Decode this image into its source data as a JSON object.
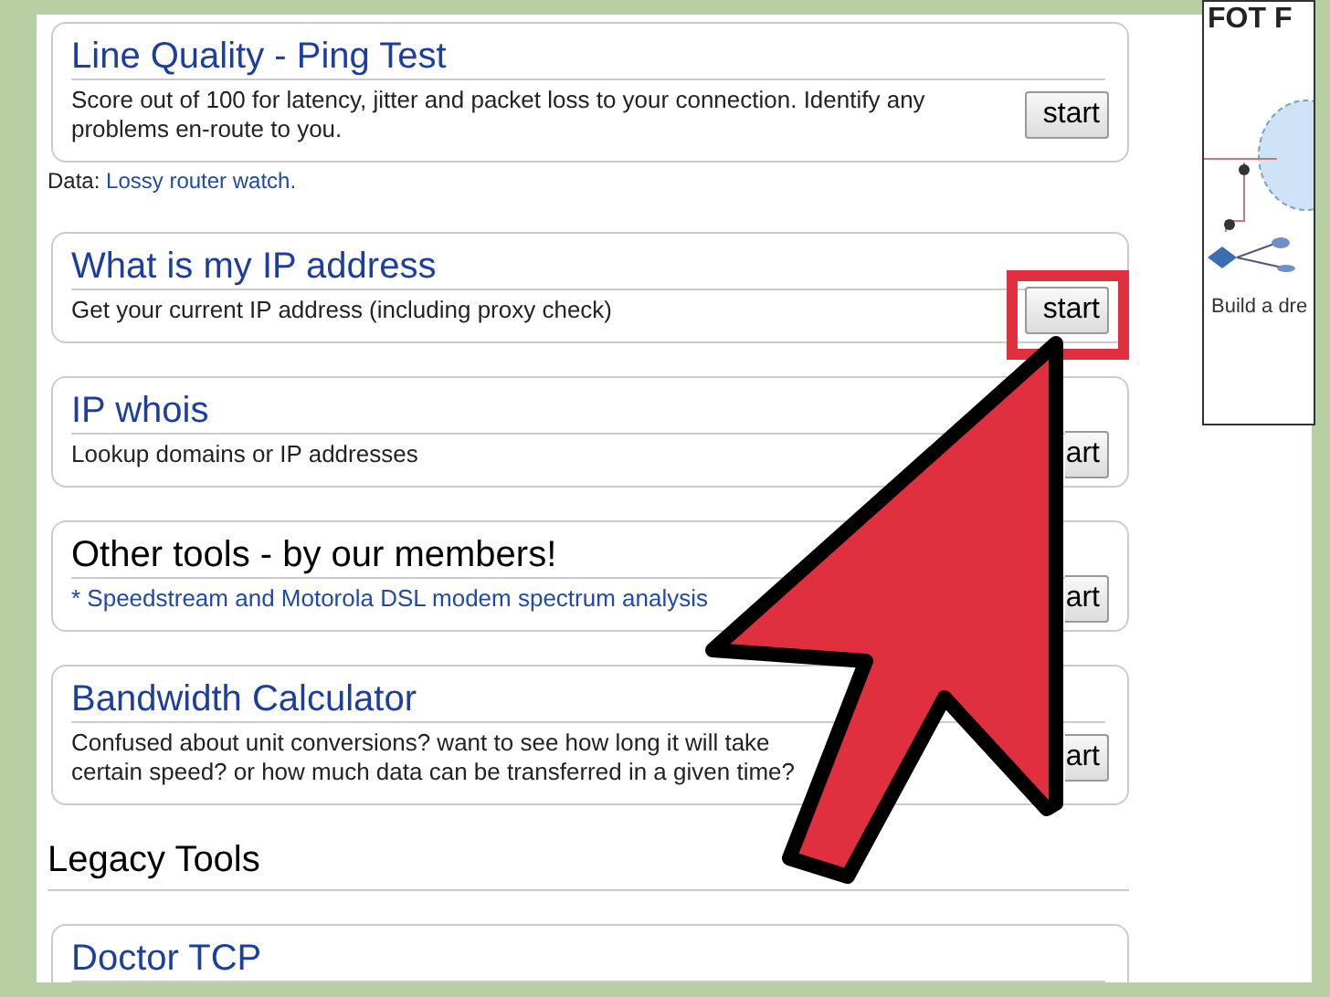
{
  "cards": [
    {
      "title": "Line Quality - Ping Test",
      "title_link": true,
      "description": "Score out of 100 for latency, jitter and packet loss to your connection. Identify any problems en-route to you.",
      "description_link": false,
      "button": "start",
      "highlighted": false,
      "note": "Data: ",
      "note_link": "Lossy router watch."
    },
    {
      "title": "What is my IP address",
      "title_link": true,
      "description": "Get your current IP address (including proxy check)",
      "description_link": false,
      "button": "start",
      "highlighted": true
    },
    {
      "title": "IP whois",
      "title_link": true,
      "description": "Lookup domains or IP addresses",
      "description_link": false,
      "button": "art",
      "highlighted": false
    },
    {
      "title": "Other tools - by our members!",
      "title_link": false,
      "description": "* Speedstream and Motorola DSL modem spectrum analysis",
      "description_link": true,
      "button": "art",
      "highlighted": false
    },
    {
      "title": "Bandwidth Calculator",
      "title_link": true,
      "description": "Confused about unit conversions? want to see how long it will take",
      "description_2": "certain speed? or how much data can be transferred in a given time?",
      "description_link": false,
      "button": "art",
      "highlighted": false
    }
  ],
  "section": {
    "heading": "Legacy Tools",
    "cards": [
      {
        "title": "Doctor TCP",
        "title_link": true
      }
    ]
  },
  "ad": {
    "heading": "FOT F",
    "caption": "Build a dre"
  }
}
